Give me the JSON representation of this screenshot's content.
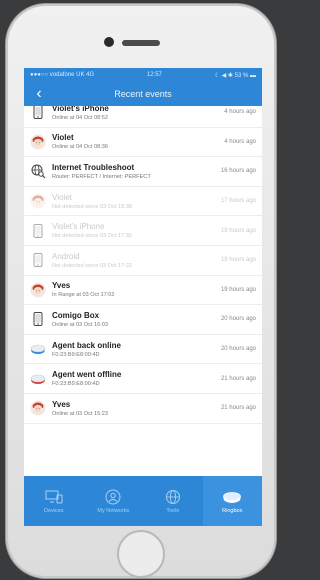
{
  "status_bar": {
    "carrier": "●●●○○ vodafone UK  4G",
    "time": "12:57",
    "right": "☾ ◀ ✱ 53 % ▬"
  },
  "nav": {
    "title": "Recent events",
    "back_glyph": "‹"
  },
  "events": [
    {
      "title": "Violet's iPhone",
      "sub": "Online at 04 Oct 08:52",
      "time": "4 hours ago",
      "icon": "phone-icon",
      "faded": false
    },
    {
      "title": "Violet",
      "sub": "Online at 04 Oct 08:36",
      "time": "4 hours ago",
      "icon": "person-avatar-icon",
      "faded": false
    },
    {
      "title": "Internet Troubleshoot",
      "sub": "Router: PERFECT / Internet: PERFECT",
      "time": "16 hours ago",
      "icon": "globe-search-icon",
      "faded": false
    },
    {
      "title": "Violet",
      "sub": "Not detected since 03 Oct 19:38",
      "time": "17 hours ago",
      "icon": "person-avatar-icon",
      "faded": true
    },
    {
      "title": "Violet's iPhone",
      "sub": "Not detected since 03 Oct 17:35",
      "time": "19 hours ago",
      "icon": "phone-icon",
      "faded": true
    },
    {
      "title": "Android",
      "sub": "Not detected since 03 Oct 17:22",
      "time": "19 hours ago",
      "icon": "phone-icon",
      "faded": true
    },
    {
      "title": "Yves",
      "sub": "In Range at 03 Oct 17:02",
      "time": "19 hours ago",
      "icon": "person-avatar-icon",
      "faded": false
    },
    {
      "title": "Comigo Box",
      "sub": "Online at 03 Oct 16:03",
      "time": "20 hours ago",
      "icon": "phone-icon",
      "faded": false
    },
    {
      "title": "Agent back online",
      "sub": "F0:23:B9:E8:00:4D",
      "time": "20 hours ago",
      "icon": "agent-online-icon",
      "faded": false
    },
    {
      "title": "Agent went offline",
      "sub": "F0:23:B9:E8:00:4D",
      "time": "21 hours ago",
      "icon": "agent-offline-icon",
      "faded": false
    },
    {
      "title": "Yves",
      "sub": "Online at 03 Oct 15:23",
      "time": "21 hours ago",
      "icon": "person-avatar-icon",
      "faded": false
    }
  ],
  "tabs": [
    {
      "label": "Devices",
      "icon": "devices-icon",
      "active": false
    },
    {
      "label": "My Networks",
      "icon": "networks-icon",
      "active": false
    },
    {
      "label": "Tools",
      "icon": "globe-icon",
      "active": false
    },
    {
      "label": "Ringbox",
      "icon": "ringbox-icon",
      "active": true
    }
  ],
  "colors": {
    "accent": "#2e86d6",
    "avatar_hair": "#c8412f",
    "agent_online": "#2e86d6",
    "agent_offline": "#d93a2f"
  }
}
